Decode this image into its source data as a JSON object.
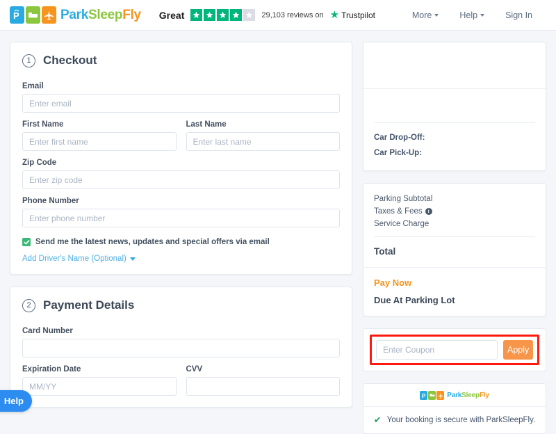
{
  "header": {
    "logo": {
      "park": "Park",
      "sleep": "Sleep",
      "fly": "Fly",
      "tiles": [
        "parking-p-icon",
        "bed-icon",
        "airplane-icon"
      ]
    },
    "trustpilot": {
      "rating_word": "Great",
      "stars_filled": 4,
      "stars_total": 5,
      "reviews_text": "29,103 reviews on",
      "brand": "Trustpilot",
      "star_color": "#00b67a"
    },
    "nav": [
      {
        "label": "More",
        "has_caret": true
      },
      {
        "label": "Help",
        "has_caret": true
      },
      {
        "label": "Sign In",
        "has_caret": false
      }
    ]
  },
  "checkout": {
    "step": "1",
    "title": "Checkout",
    "email": {
      "label": "Email",
      "placeholder": "Enter email",
      "value": ""
    },
    "first_name": {
      "label": "First Name",
      "placeholder": "Enter first name",
      "value": ""
    },
    "last_name": {
      "label": "Last Name",
      "placeholder": "Enter last name",
      "value": ""
    },
    "zip": {
      "label": "Zip Code",
      "placeholder": "Enter zip code",
      "value": ""
    },
    "phone": {
      "label": "Phone Number",
      "placeholder": "Enter phone number",
      "value": ""
    },
    "newsletter": {
      "checked": true,
      "label": "Send me the latest news, updates and special offers via email"
    },
    "driver_link": "Add Driver's Name (Optional)"
  },
  "payment": {
    "step": "2",
    "title": "Payment Details",
    "card_number": {
      "label": "Card Number",
      "placeholder": "",
      "value": ""
    },
    "expiration": {
      "label": "Expiration Date",
      "placeholder": "MM/YY",
      "value": ""
    },
    "cvv": {
      "label": "CVV",
      "placeholder": "",
      "value": ""
    }
  },
  "summary": {
    "car_drop_off": "Car Drop-Off:",
    "car_pick_up": "Car Pick-Up:",
    "parking_subtotal": "Parking Subtotal",
    "taxes_fees": "Taxes & Fees",
    "service_charge": "Service Charge",
    "total": "Total",
    "pay_now": "Pay Now",
    "due_at_parking_lot": "Due At Parking Lot",
    "pay_now_color": "#f7941e"
  },
  "coupon": {
    "placeholder": "Enter Coupon",
    "value": "",
    "apply_label": "Apply",
    "apply_color": "#f79548",
    "highlight_color": "#ff1a0d"
  },
  "secure": {
    "logo_park": "Park",
    "logo_sleep": "Sleep",
    "logo_fly": "Fly",
    "message": "Your booking is secure with ParkSleepFly.",
    "check_color": "#14a55c"
  },
  "help_widget": {
    "label": "Help"
  }
}
